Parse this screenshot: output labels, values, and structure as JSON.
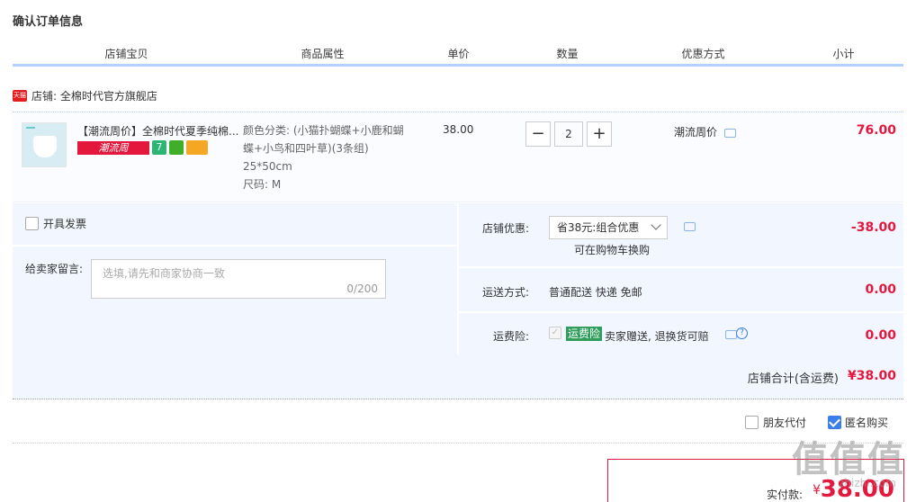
{
  "page": {
    "title": "确认订单信息"
  },
  "table": {
    "columns": [
      "店铺宝贝",
      "商品属性",
      "单价",
      "数量",
      "优惠方式",
      "小计"
    ]
  },
  "shop": {
    "badge": "天猫",
    "name": "店铺: 全棉时代官方旗舰店"
  },
  "item": {
    "title": "【潮流周价】全棉时代夏季纯棉...",
    "promo_tag": "潮流周",
    "attrs": "颜色分类: (小猫扑蝴蝶+小鹿和蝴蝶+小鸟和四叶草)(3条组) 25*50cm",
    "size": "尺码: M",
    "price": "38.00",
    "quantity": "2",
    "qty_minus": "−",
    "qty_plus": "+",
    "discount": "潮流周价",
    "subtotal": "76.00"
  },
  "invoice": {
    "label": "开具发票"
  },
  "message": {
    "label": "给卖家留言:",
    "placeholder": "选填,请先和商家协商一致",
    "counter": "0/200"
  },
  "shop_discount": {
    "label": "店铺优惠:",
    "selected": "省38元:组合优惠",
    "hint": "可在购物车换购",
    "value": "-38.00"
  },
  "shipping": {
    "label": "运送方式:",
    "method": "普通配送 快递 免邮",
    "value": "0.00"
  },
  "insurance": {
    "label": "运费险:",
    "tag": "运费险",
    "desc": "卖家赠送, 退换货可赔",
    "value": "0.00"
  },
  "total": {
    "label": "店铺合计(含运费)",
    "value": "¥38.00"
  },
  "options": {
    "friend_pay": "朋友代付",
    "anonymous": "匿名购买"
  },
  "payment": {
    "label": "实付款:",
    "currency": "¥",
    "value": "38.00"
  },
  "watermark": {
    "text": "值值值",
    "url": "zhizhi.com"
  },
  "colors": {
    "accent": "#e4173d",
    "header_border": "#b2d1ff",
    "panel_bg": "#f2f7ff",
    "checkbox_blue": "#3d7fea"
  }
}
